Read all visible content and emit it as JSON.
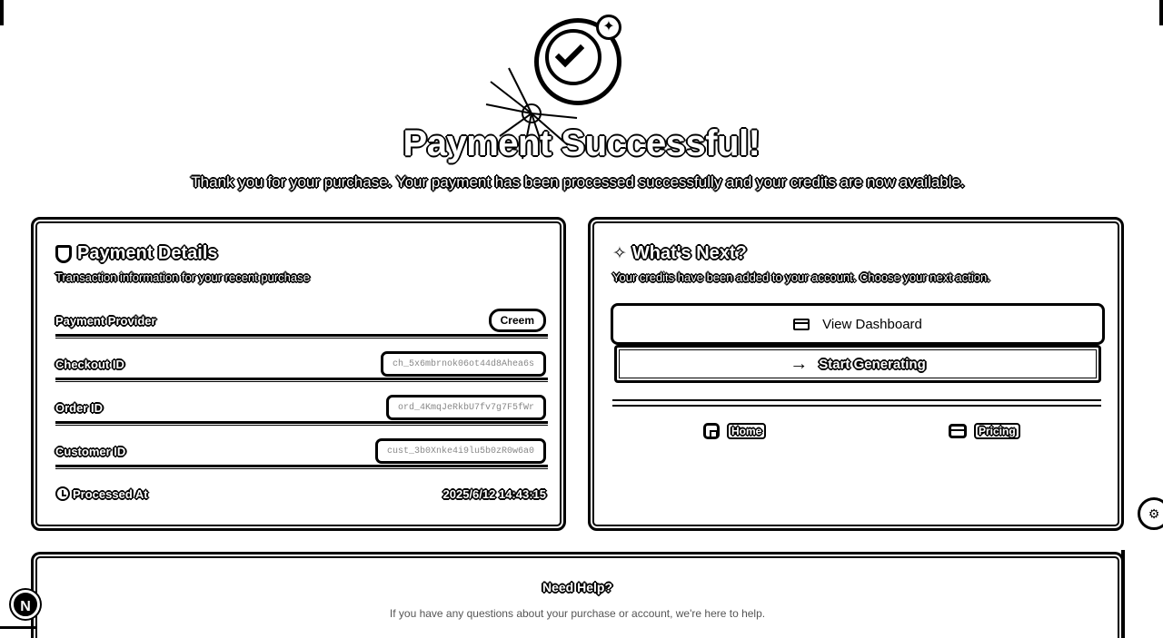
{
  "hero": {
    "title": "Payment Successful!",
    "subtitle": "Thank you for your purchase. Your payment has been processed successfully and your credits are now available."
  },
  "payment_details": {
    "title": "Payment Details",
    "description": "Transaction information for your recent purchase",
    "rows": [
      {
        "label": "Payment Provider",
        "value": "Creem"
      },
      {
        "label": "Checkout ID",
        "value": "ch_5x6mbrnok06ot44d8Ahea6s"
      },
      {
        "label": "Order ID",
        "value": "ord_4KmqJeRkbU7fv7g7F5fWr"
      },
      {
        "label": "Customer ID",
        "value": "cust_3b0Xnke4i9lu5b0zR0w6a0"
      },
      {
        "label": "Processed At",
        "value": "2025/6/12 14:43:15"
      }
    ]
  },
  "whats_next": {
    "title": "What's Next?",
    "description": "Your credits have been added to your account. Choose your next action.",
    "view_dashboard": "View Dashboard",
    "start_generating": "Start Generating",
    "home": "Home",
    "pricing": "Pricing"
  },
  "help": {
    "title": "Need Help?",
    "text": "If you have any questions about your purchase or account, we're here to help."
  },
  "badges": {
    "next": "N",
    "side": "⚙"
  }
}
